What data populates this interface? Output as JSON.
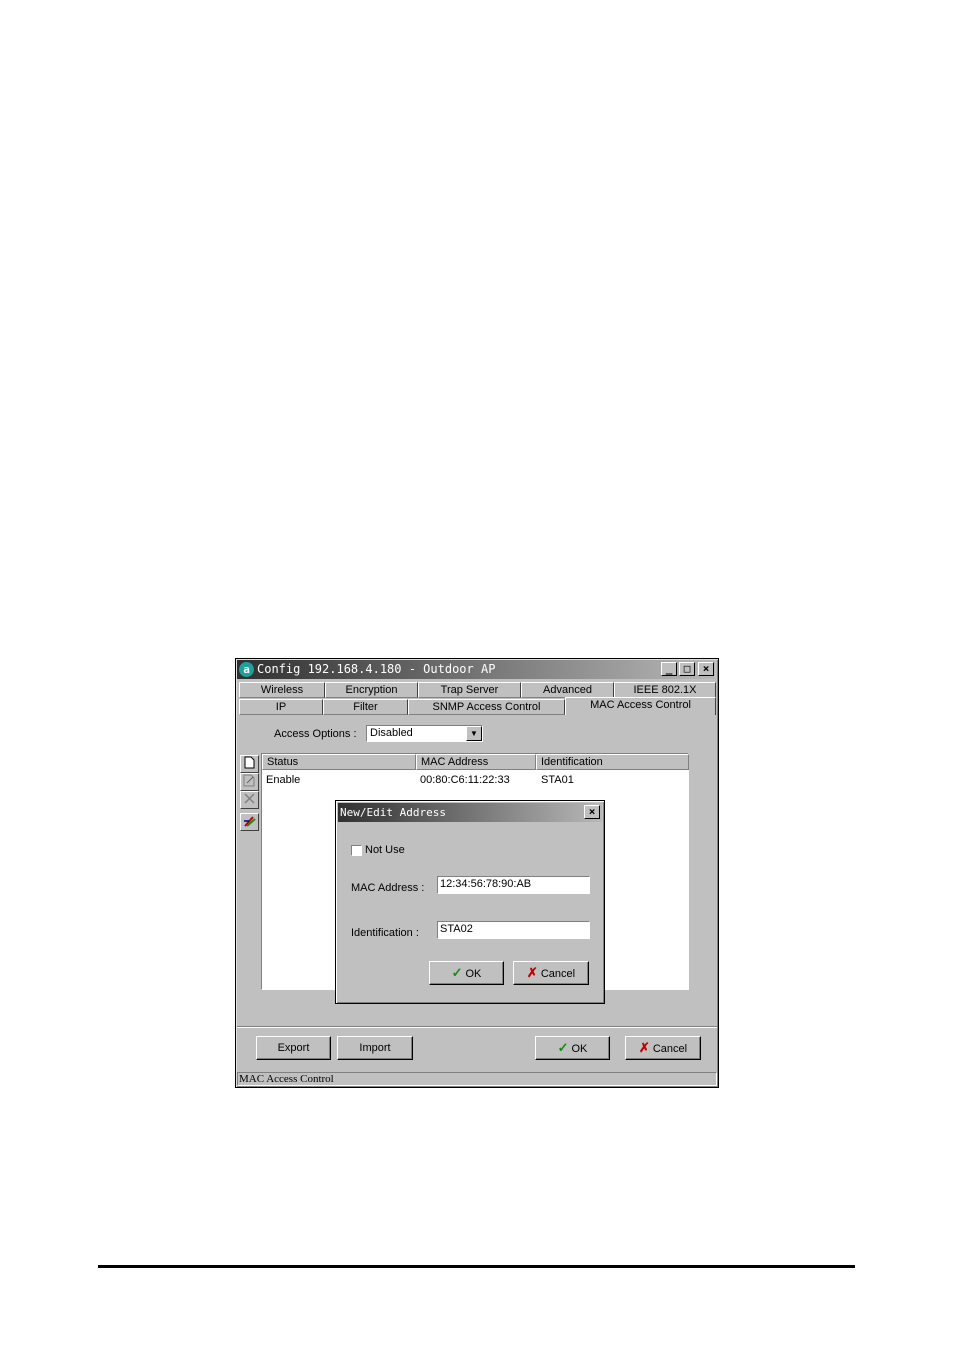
{
  "window": {
    "title": "Config 192.168.4.180 - Outdoor AP",
    "app_icon_glyph": "a",
    "minimize_glyph": "_",
    "maximize_glyph": "□",
    "close_glyph": "×"
  },
  "tabs_row1": [
    "Wireless",
    "Encryption",
    "Trap Server",
    "Advanced",
    "IEEE 802.1X"
  ],
  "tabs_row2": [
    "IP",
    "Filter",
    "SNMP Access Control",
    "MAC Access Control"
  ],
  "active_tab": "MAC Access Control",
  "access_options": {
    "label": "Access Options :",
    "value": "Disabled"
  },
  "table": {
    "columns": [
      "Status",
      "MAC Address",
      "Identification"
    ],
    "rows": [
      {
        "status": "Enable",
        "mac": "00:80:C6:11:22:33",
        "identification": "STA01"
      }
    ]
  },
  "side_buttons": [
    "new-icon",
    "edit-icon",
    "delete-icon",
    "color-icon"
  ],
  "dialog": {
    "title": "New/Edit Address",
    "close_glyph": "×",
    "not_use_label": "Not Use",
    "not_use_checked": false,
    "mac_label": "MAC Address :",
    "mac_value": "12:34:56:78:90:AB",
    "ident_label": "Identification :",
    "ident_value": "STA02",
    "ok_label": "OK",
    "cancel_label": "Cancel"
  },
  "bottom_buttons": {
    "export": "Export",
    "import": "Import",
    "ok": "OK",
    "cancel": "Cancel"
  },
  "status_bar": "MAC Access Control"
}
